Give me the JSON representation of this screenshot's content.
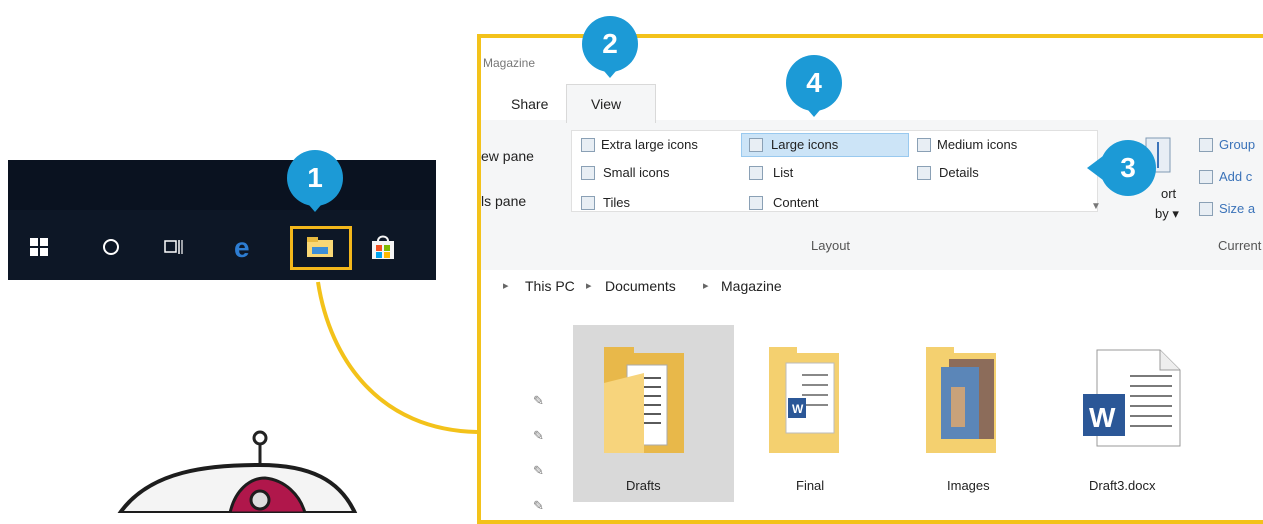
{
  "taskbar": {
    "icons": [
      "windows-start-icon",
      "cortana-circle-icon",
      "task-view-icon",
      "edge-icon",
      "file-explorer-icon",
      "store-icon"
    ]
  },
  "callouts": [
    "1",
    "2",
    "3",
    "4"
  ],
  "explorer": {
    "title": "Magazine",
    "tabs": {
      "share": "Share",
      "view": "View"
    },
    "panes": {
      "nav": "ew pane",
      "details": "ls pane"
    },
    "layout": {
      "items": [
        "Extra large icons",
        "Large icons",
        "Medium icons",
        "Small icons",
        "List",
        "Details",
        "Tiles",
        "Content"
      ],
      "group_label": "Layout",
      "selected": "Large icons"
    },
    "sort": {
      "label_top": "ort",
      "label_bottom": "by ▾"
    },
    "current_view": {
      "items": [
        "Group",
        "Add c",
        "Size a"
      ],
      "group_label": "Current"
    },
    "breadcrumb": [
      "This PC",
      "Documents",
      "Magazine"
    ],
    "files": [
      "Drafts",
      "Final",
      "Images",
      "Draft3.docx"
    ],
    "selected_file": "Drafts"
  },
  "colors": {
    "accent_yellow": "#f3c21a",
    "callout_blue": "#1c9ad6",
    "taskbar": "#0d1726"
  }
}
